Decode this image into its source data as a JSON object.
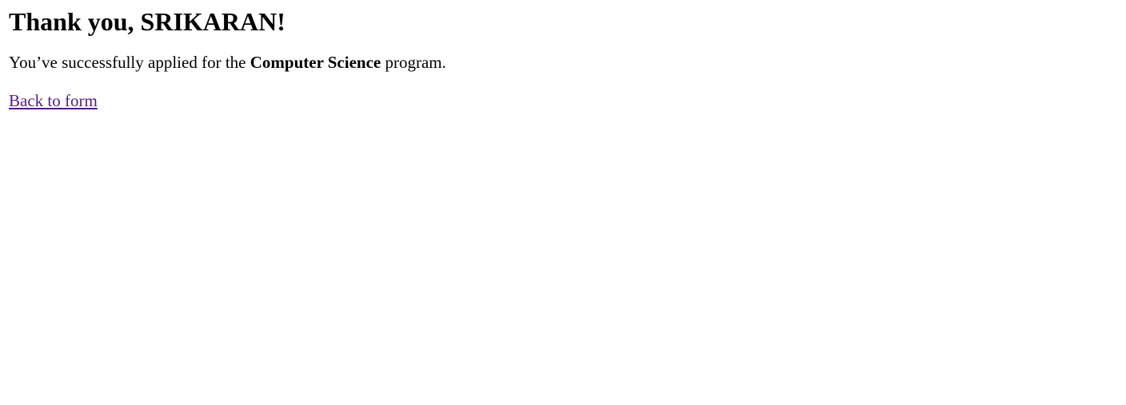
{
  "heading": {
    "prefix": "Thank you, ",
    "name": "SRIKARAN",
    "suffix": "!"
  },
  "message": {
    "before": "You’ve successfully applied for the ",
    "program": "Computer Science",
    "after": " program."
  },
  "back_link": {
    "label": "Back to form",
    "color": "#551a8b"
  }
}
